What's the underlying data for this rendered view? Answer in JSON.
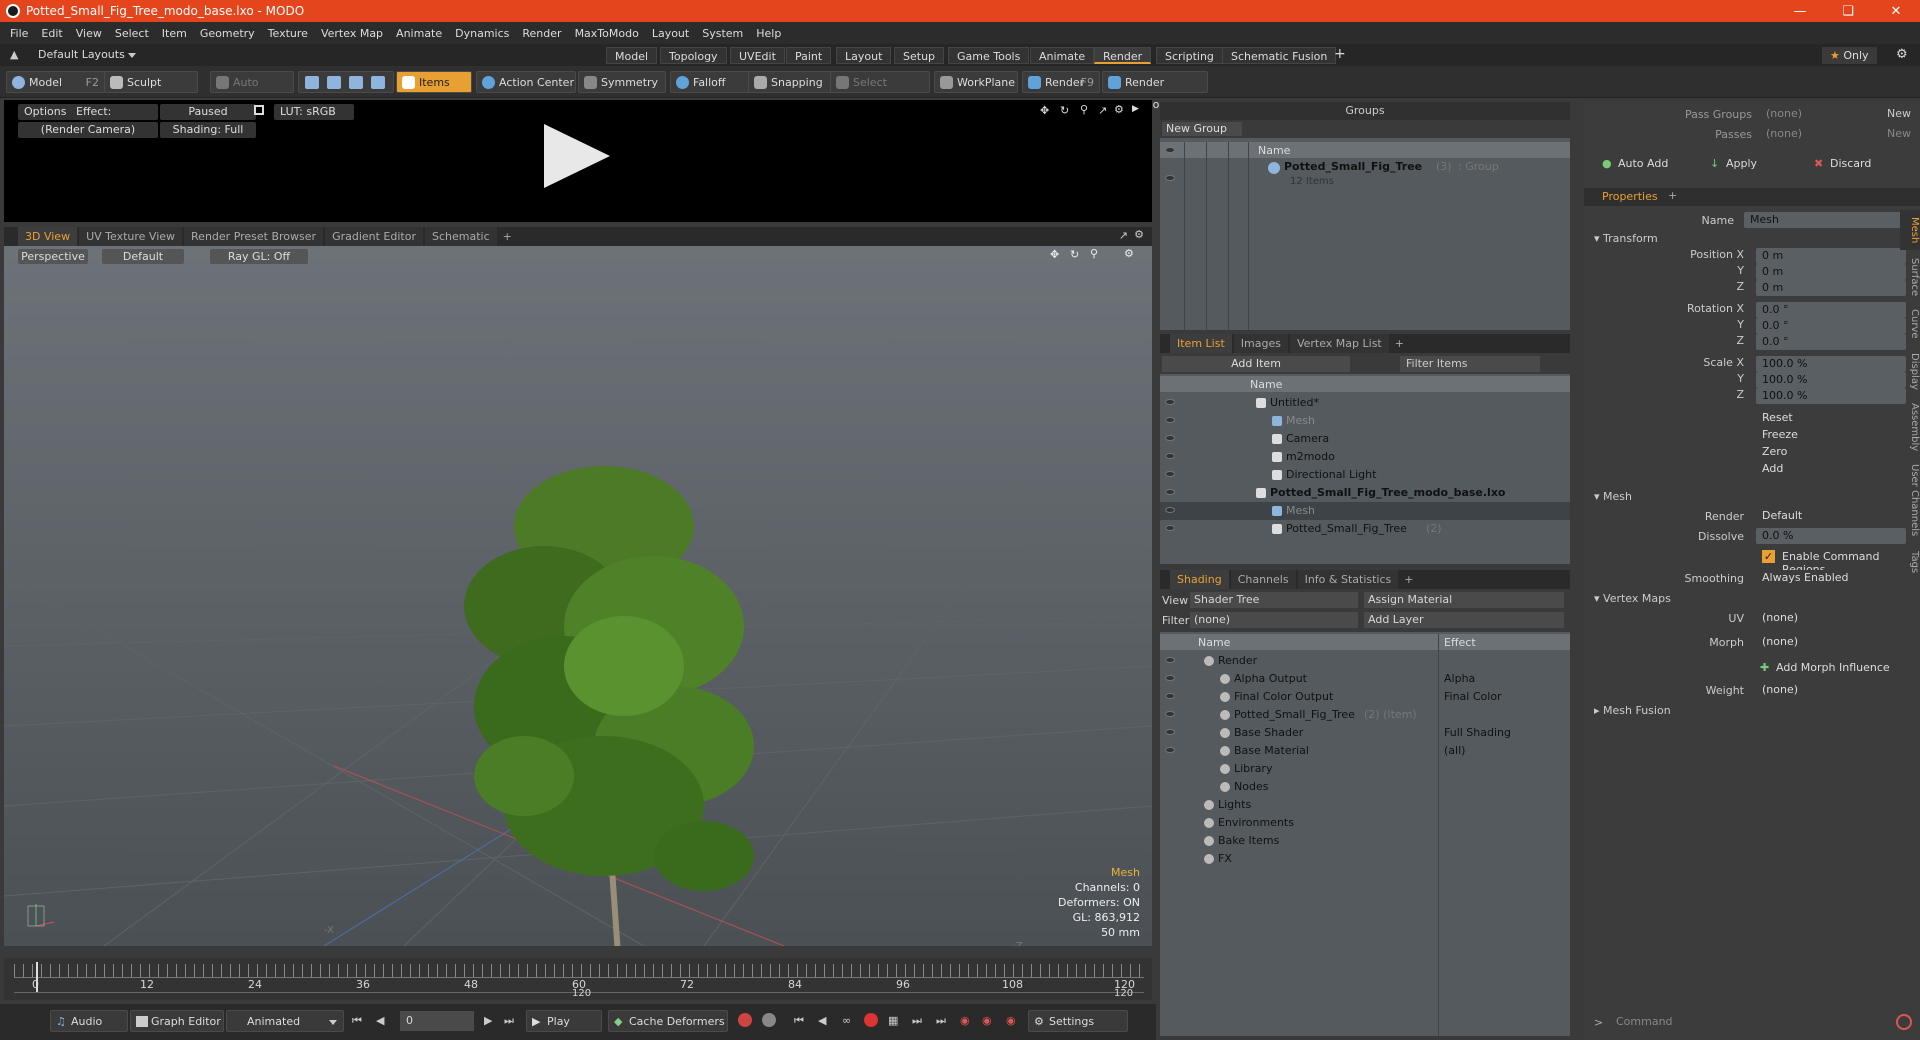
{
  "window": {
    "title": "Potted_Small_Fig_Tree_modo_base.lxo - MODO"
  },
  "menu": [
    "File",
    "Edit",
    "View",
    "Select",
    "Item",
    "Geometry",
    "Texture",
    "Vertex Map",
    "Animate",
    "Dynamics",
    "Render",
    "MaxToModo",
    "Layout",
    "System",
    "Help"
  ],
  "layout": {
    "preset": "Default Layouts",
    "tabs": [
      "Model",
      "Topology",
      "UVEdit",
      "Paint",
      "Layout",
      "Setup",
      "Game Tools",
      "Animate",
      "Render",
      "Scripting",
      "Schematic Fusion"
    ],
    "active_tab": "Render",
    "only_label": "Only"
  },
  "toolbar": {
    "model": "Model",
    "model_key": "F2",
    "sculpt": "Sculpt",
    "auto_select": "Auto Select",
    "items": "Items",
    "action_center": "Action Center",
    "symmetry": "Symmetry",
    "falloff": "Falloff",
    "snapping": "Snapping",
    "select_through": "Select Through",
    "workplane": "WorkPlane",
    "render": "Render",
    "render_key": "F9",
    "render_window": "Render Window"
  },
  "render_preview": {
    "options": "Options",
    "effect": "Effect: (Shadi...",
    "paused": "Paused",
    "lut": "LUT: sRGB",
    "camera": "(Render Camera)",
    "shading": "Shading: Full"
  },
  "view_tabs": [
    "3D View",
    "UV Texture View",
    "Render Preset Browser",
    "Gradient Editor",
    "Schematic"
  ],
  "viewport": {
    "perspective": "Perspective",
    "default": "Default",
    "raygl": "Ray GL: Off",
    "stats": {
      "type": "Mesh",
      "channels": "Channels: 0",
      "deformers": "Deformers: ON",
      "gl": "GL: 863,912",
      "focal": "50 mm"
    }
  },
  "timeline": {
    "ticks": [
      "0",
      "12",
      "24",
      "36",
      "48",
      "60",
      "72",
      "84",
      "96",
      "108",
      "120"
    ],
    "mid_label": "120",
    "end_label": "120"
  },
  "bottombar": {
    "audio": "Audio",
    "graph_editor": "Graph Editor",
    "animated": "Animated",
    "frame": "0",
    "play": "Play",
    "cache": "Cache Deformers",
    "settings": "Settings"
  },
  "groups": {
    "title": "Groups",
    "new_group": "New Group",
    "col_name": "Name",
    "item_name": "Potted_Small_Fig_Tree",
    "item_count": "(3)",
    "item_type": ": Group",
    "item_sub": "12 Items"
  },
  "itemlist": {
    "tabs": [
      "Item List",
      "Images",
      "Vertex Map List"
    ],
    "add_item": "Add Item",
    "filter": "Filter Items",
    "col_name": "Name",
    "rows": [
      {
        "name": "Untitled*",
        "indent": 0,
        "bold": false,
        "dim": false
      },
      {
        "name": "Mesh",
        "indent": 1,
        "bold": false,
        "dim": true
      },
      {
        "name": "Camera",
        "indent": 1,
        "bold": false,
        "dim": false
      },
      {
        "name": "m2modo",
        "indent": 1,
        "bold": false,
        "dim": false
      },
      {
        "name": "Directional Light",
        "indent": 1,
        "bold": false,
        "dim": false
      },
      {
        "name": "Potted_Small_Fig_Tree_modo_base.lxo",
        "indent": 0,
        "bold": true,
        "dim": false
      },
      {
        "name": "Mesh",
        "indent": 1,
        "bold": false,
        "dim": true
      },
      {
        "name": "Potted_Small_Fig_Tree",
        "indent": 1,
        "bold": false,
        "dim": false,
        "suffix": "(2)"
      }
    ]
  },
  "shading": {
    "tabs": [
      "Shading",
      "Channels",
      "Info & Statistics"
    ],
    "view_label": "View",
    "view_value": "Shader Tree",
    "assign": "Assign Material",
    "filter_label": "Filter",
    "filter_value": "(none)",
    "add_layer": "Add Layer",
    "col_name": "Name",
    "col_effect": "Effect",
    "rows": [
      {
        "name": "Render",
        "effect": "",
        "indent": 0
      },
      {
        "name": "Alpha Output",
        "effect": "Alpha",
        "indent": 1
      },
      {
        "name": "Final Color Output",
        "effect": "Final Color",
        "indent": 1
      },
      {
        "name": "Potted_Small_Fig_Tree",
        "suffix": "(2) (Item)",
        "effect": "",
        "indent": 1
      },
      {
        "name": "Base Shader",
        "effect": "Full Shading",
        "indent": 1
      },
      {
        "name": "Base Material",
        "effect": "(all)",
        "indent": 1
      },
      {
        "name": "Library",
        "effect": "",
        "indent": 1
      },
      {
        "name": "Nodes",
        "effect": "",
        "indent": 1
      },
      {
        "name": "Lights",
        "effect": "",
        "indent": 0
      },
      {
        "name": "Environments",
        "effect": "",
        "indent": 0
      },
      {
        "name": "Bake Items",
        "effect": "",
        "indent": 0
      },
      {
        "name": "FX",
        "effect": "",
        "indent": 0
      }
    ]
  },
  "passes": {
    "pass_groups": "Pass Groups",
    "passes": "Passes",
    "none": "(none)",
    "new": "New",
    "auto_add": "Auto Add",
    "apply": "Apply",
    "discard": "Discard"
  },
  "properties": {
    "tab": "Properties",
    "name_label": "Name",
    "name_value": "Mesh",
    "transform": "Transform",
    "position_x": "Position X",
    "rotation_x": "Rotation X",
    "scale_x": "Scale X",
    "y": "Y",
    "z": "Z",
    "pos": [
      "0 m",
      "0 m",
      "0 m"
    ],
    "rot": [
      "0.0 °",
      "0.0 °",
      "0.0 °"
    ],
    "scale": [
      "100.0 %",
      "100.0 %",
      "100.0 %"
    ],
    "reset": "Reset",
    "freeze": "Freeze",
    "zero": "Zero",
    "add": "Add",
    "mesh": "Mesh",
    "render_label": "Render",
    "render_value": "Default",
    "dissolve_label": "Dissolve",
    "dissolve_value": "0.0 %",
    "enable_cmd": "Enable Command Regions",
    "smoothing_label": "Smoothing",
    "smoothing_value": "Always Enabled",
    "vertex_maps": "Vertex Maps",
    "uv_label": "UV",
    "uv_value": "(none)",
    "morph_label": "Morph",
    "morph_value": "(none)",
    "add_morph": "Add Morph Influence",
    "weight_label": "Weight",
    "weight_value": "(none)",
    "mesh_fusion": "Mesh Fusion",
    "side_tabs": [
      "Mesh",
      "Surface",
      "Curve",
      "Display",
      "Assembly",
      "User Channels",
      "Tags"
    ]
  },
  "command": {
    "placeholder": "Command"
  }
}
